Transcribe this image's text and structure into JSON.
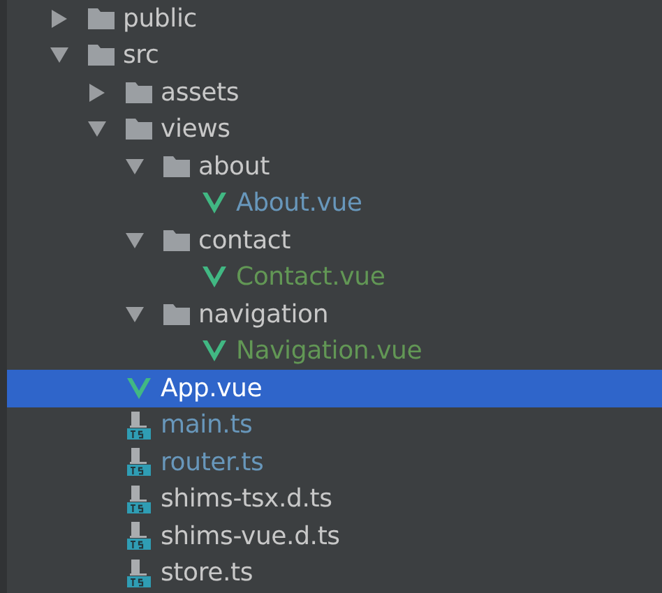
{
  "tree": [
    {
      "name": "public",
      "kind": "folder",
      "expanded": false,
      "selected": false,
      "color": "#c8c8c8"
    },
    {
      "name": "src",
      "kind": "folder",
      "expanded": true,
      "selected": false,
      "color": "#c8c8c8",
      "children": [
        {
          "name": "assets",
          "kind": "folder",
          "expanded": false,
          "selected": false,
          "color": "#c8c8c8"
        },
        {
          "name": "views",
          "kind": "folder",
          "expanded": true,
          "selected": false,
          "color": "#c8c8c8",
          "children": [
            {
              "name": "about",
              "kind": "folder",
              "expanded": true,
              "selected": false,
              "color": "#c8c8c8",
              "children": [
                {
                  "name": "About.vue",
                  "kind": "vue",
                  "selected": false,
                  "color": "#6897bb"
                }
              ]
            },
            {
              "name": "contact",
              "kind": "folder",
              "expanded": true,
              "selected": false,
              "color": "#c8c8c8",
              "children": [
                {
                  "name": "Contact.vue",
                  "kind": "vue",
                  "selected": false,
                  "color": "#629755"
                }
              ]
            },
            {
              "name": "navigation",
              "kind": "folder",
              "expanded": true,
              "selected": false,
              "color": "#c8c8c8",
              "children": [
                {
                  "name": "Navigation.vue",
                  "kind": "vue",
                  "selected": false,
                  "color": "#629755"
                }
              ]
            }
          ]
        },
        {
          "name": "App.vue",
          "kind": "vue",
          "selected": true
        },
        {
          "name": "main.ts",
          "kind": "ts",
          "selected": false,
          "color": "#6897bb"
        },
        {
          "name": "router.ts",
          "kind": "ts",
          "selected": false,
          "color": "#6897bb"
        },
        {
          "name": "shims-tsx.d.ts",
          "kind": "ts",
          "selected": false,
          "color": "#c8c8c8"
        },
        {
          "name": "shims-vue.d.ts",
          "kind": "ts",
          "selected": false,
          "color": "#c8c8c8"
        },
        {
          "name": "store.ts",
          "kind": "ts",
          "selected": false,
          "color": "#c8c8c8"
        }
      ]
    }
  ]
}
